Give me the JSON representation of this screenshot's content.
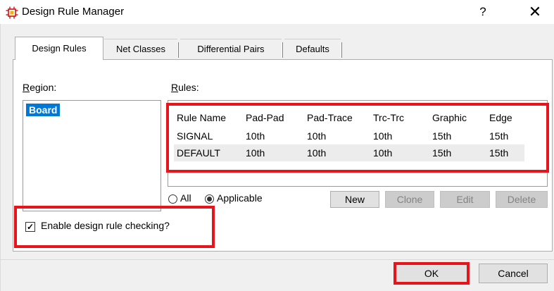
{
  "window": {
    "title": "Design Rule Manager",
    "help_label": "?",
    "close_label": "✕"
  },
  "tabs": [
    {
      "label": "Design Rules",
      "active": true
    },
    {
      "label": "Net Classes",
      "active": false
    },
    {
      "label": "Differential Pairs",
      "active": false
    },
    {
      "label": "Defaults",
      "active": false
    }
  ],
  "region": {
    "label_first": "R",
    "label_rest": "egion:",
    "items": [
      "Board"
    ]
  },
  "rules": {
    "label_first": "R",
    "label_rest": "ules:",
    "columns": [
      "Rule Name",
      "Pad-Pad",
      "Pad-Trace",
      "Trc-Trc",
      "Graphic",
      "Edge"
    ],
    "rows": [
      [
        "SIGNAL",
        "10th",
        "10th",
        "10th",
        "15th",
        "15th"
      ],
      [
        "DEFAULT",
        "10th",
        "10th",
        "10th",
        "15th",
        "15th"
      ]
    ]
  },
  "filter": {
    "all_label": "All",
    "applicable_label": "Applicable",
    "selected": "Applicable"
  },
  "rule_buttons": {
    "new": "New",
    "clone": "Clone",
    "edit": "Edit",
    "delete": "Delete"
  },
  "drc_checkbox": {
    "label": "Enable design rule checking?",
    "checked": true,
    "mark": "✓"
  },
  "footer": {
    "ok": "OK",
    "cancel": "Cancel"
  },
  "colors": {
    "highlight_red": "#e8141b",
    "selection_blue": "#0078d7"
  }
}
